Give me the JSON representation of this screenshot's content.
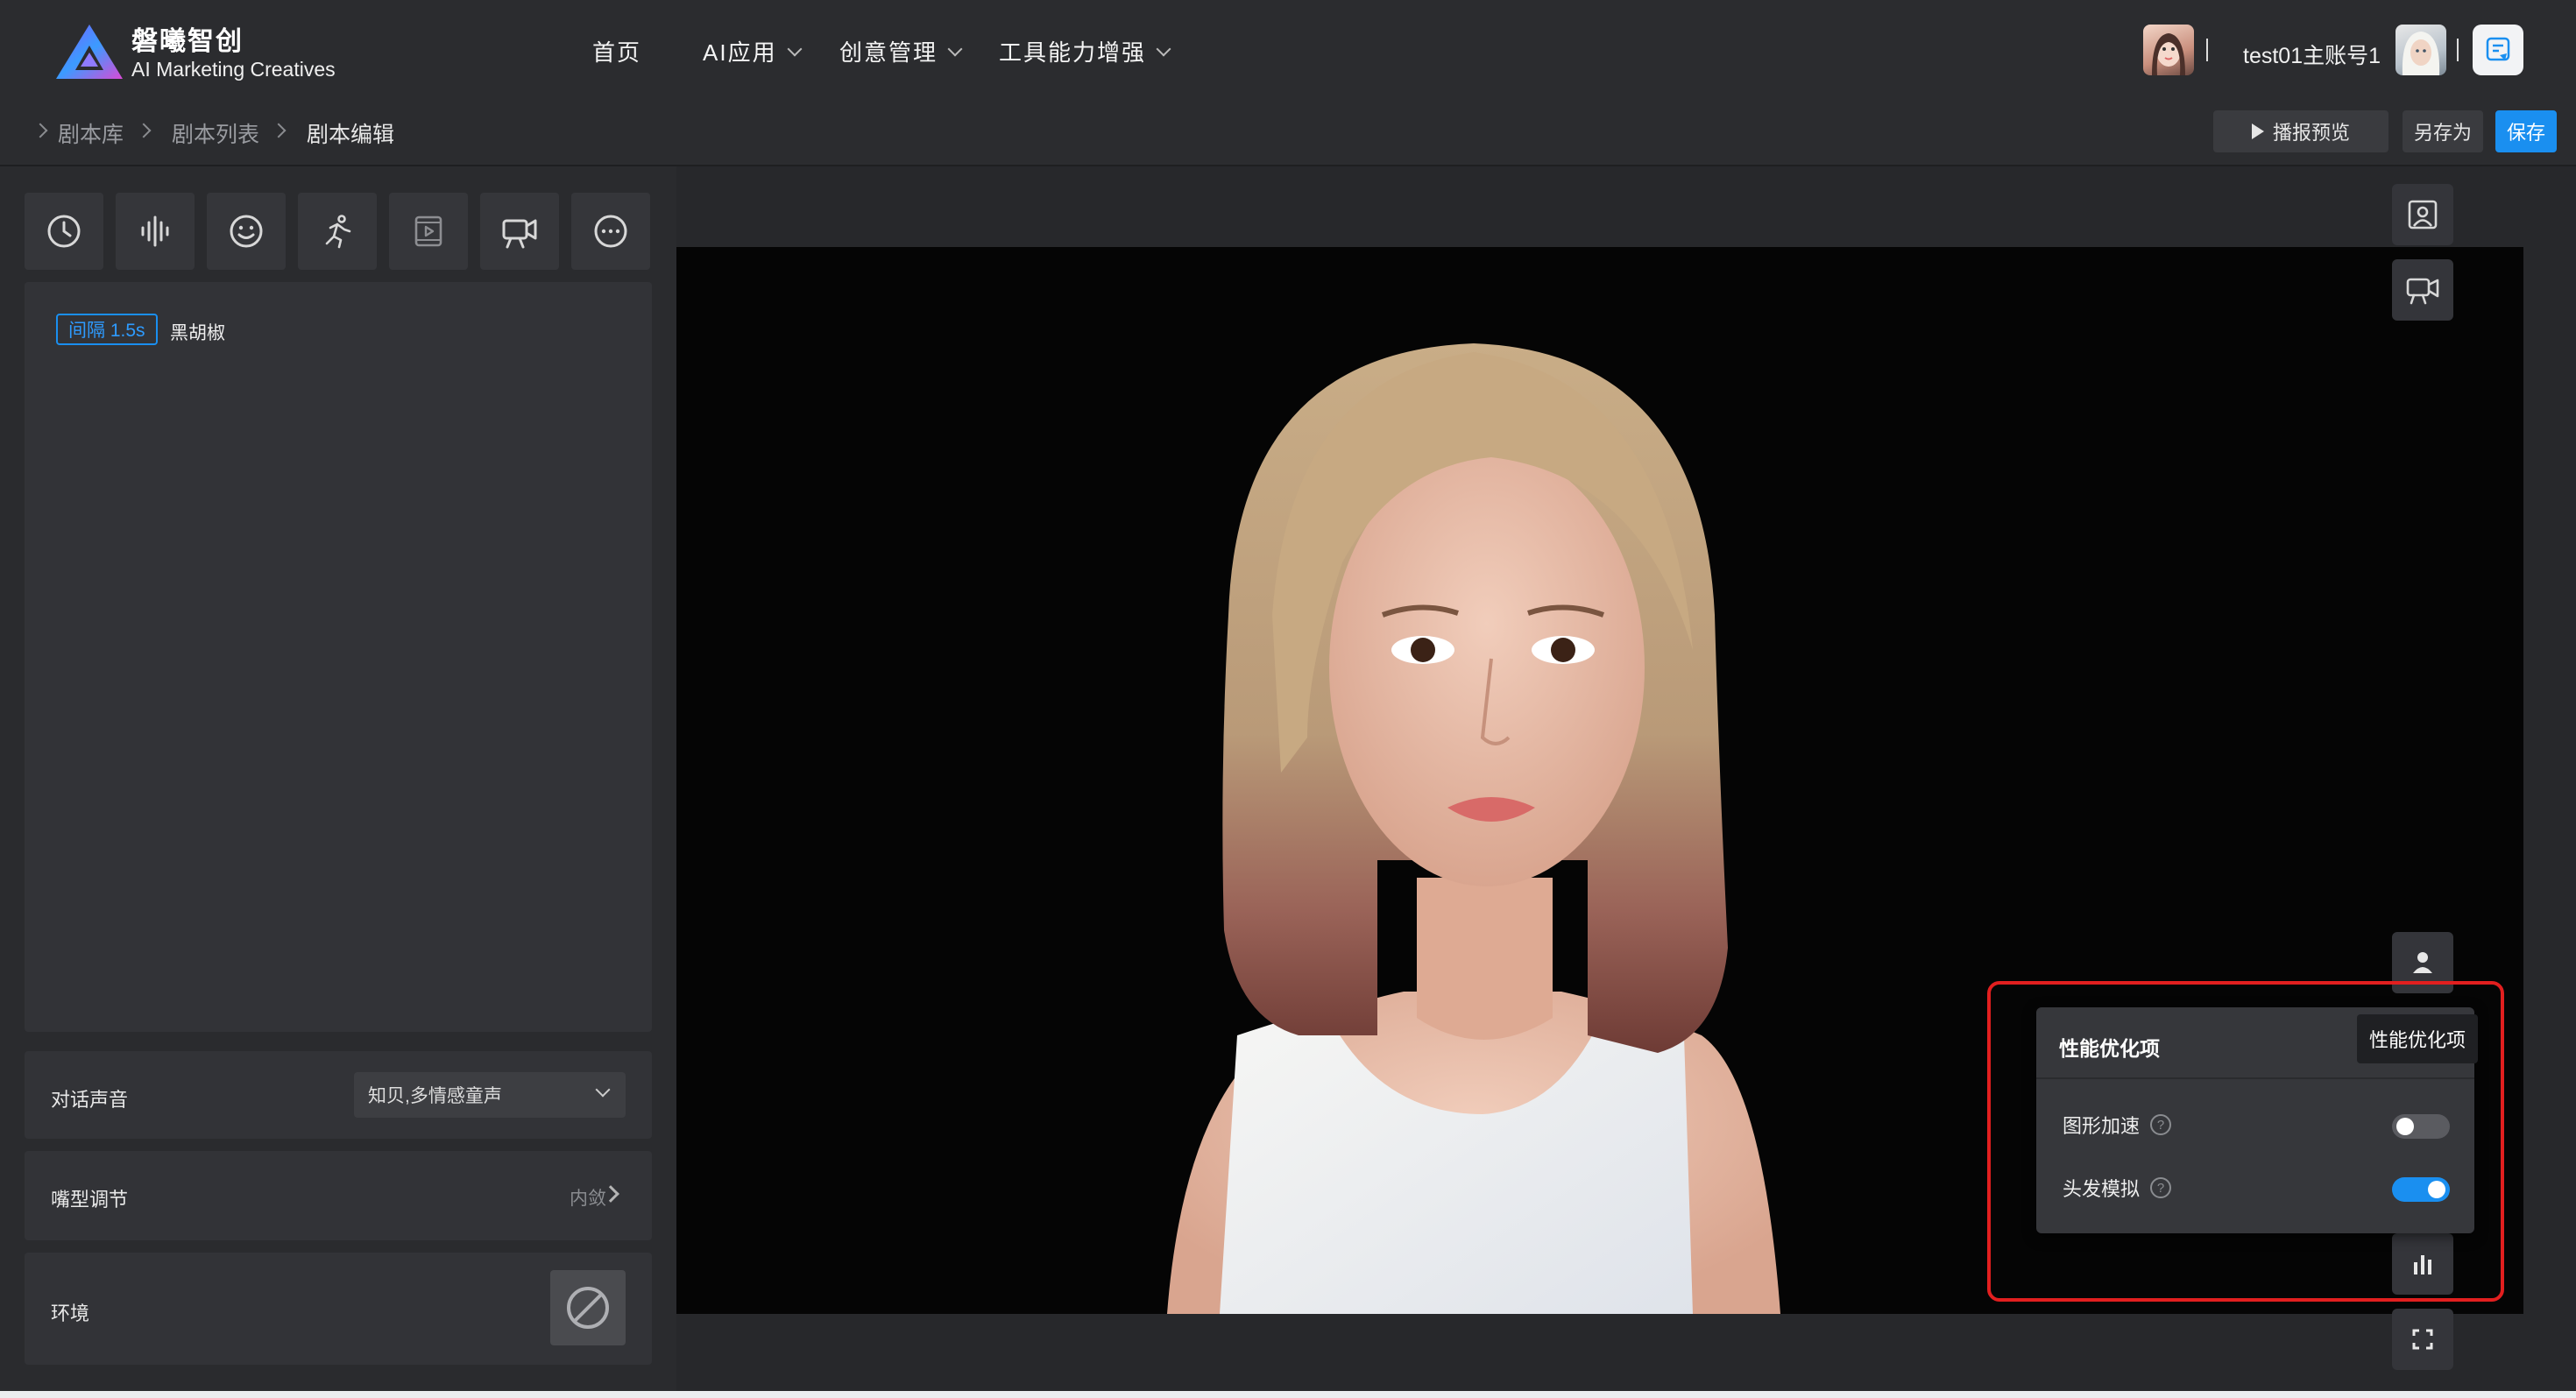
{
  "header": {
    "brand_title": "磐曦智创",
    "brand_subtitle": "AI Marketing Creatives",
    "nav": [
      {
        "label": "首页",
        "has_caret": false
      },
      {
        "label": "AI应用",
        "has_caret": true
      },
      {
        "label": "创意管理",
        "has_caret": true
      },
      {
        "label": "工具能力增强",
        "has_caret": true
      }
    ],
    "username": "test01主账号1"
  },
  "breadcrumb": [
    "剧本库",
    "剧本列表",
    "剧本编辑"
  ],
  "actions": {
    "preview": "播报预览",
    "save_as": "另存为",
    "save": "保存"
  },
  "toolbar_icons": [
    "clock-icon",
    "waveform-icon",
    "smiley-icon",
    "running-figure-icon",
    "video-play-icon",
    "camera-icon",
    "more-icon"
  ],
  "script": {
    "tag": "间隔 1.5s",
    "text": "黑胡椒"
  },
  "settings": {
    "voice_label": "对话声音",
    "voice_value": "知贝,多情感童声",
    "mouth_label": "嘴型调节",
    "mouth_value": "内敛",
    "env_label": "环境"
  },
  "perf_panel": {
    "title": "性能优化项",
    "tooltip": "性能优化项",
    "items": [
      {
        "label": "图形加速",
        "enabled": false
      },
      {
        "label": "头发模拟",
        "enabled": true
      }
    ]
  },
  "colors": {
    "accent": "#1a8ff0",
    "highlight": "#e21f1f",
    "toggle_off": "#5a5b60"
  }
}
